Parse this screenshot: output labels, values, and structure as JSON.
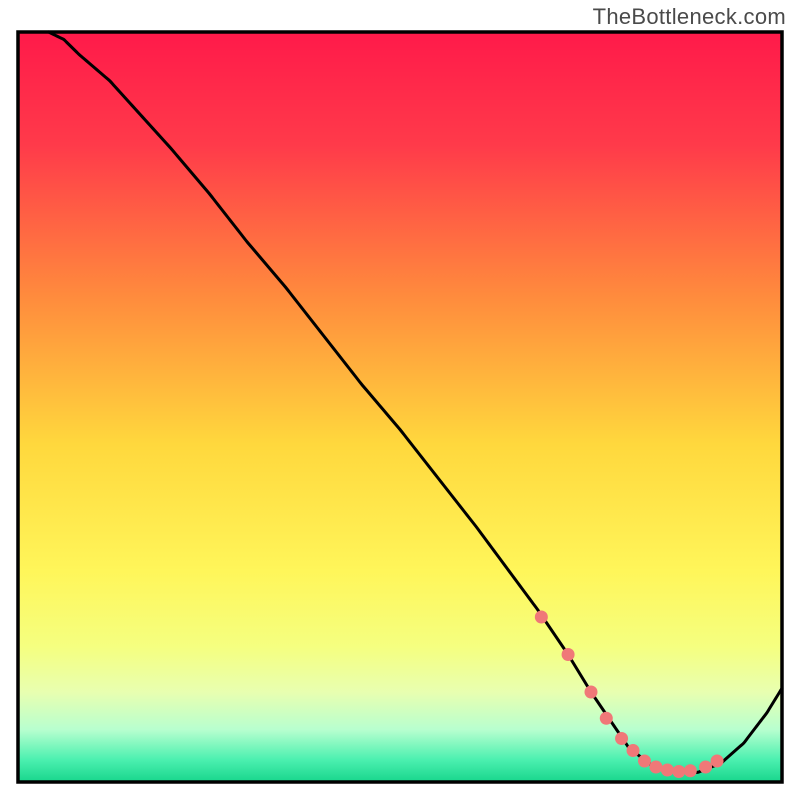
{
  "watermark": "TheBottleneck.com",
  "chart_data": {
    "type": "line",
    "title": "",
    "xlabel": "",
    "ylabel": "",
    "xlim": [
      0,
      100
    ],
    "ylim": [
      0,
      100
    ],
    "background_gradient": {
      "stops": [
        {
          "offset": 0,
          "color": "#ff1a4a"
        },
        {
          "offset": 15,
          "color": "#ff3a4a"
        },
        {
          "offset": 35,
          "color": "#ff8a3d"
        },
        {
          "offset": 55,
          "color": "#ffd83d"
        },
        {
          "offset": 72,
          "color": "#fff65a"
        },
        {
          "offset": 82,
          "color": "#f5ff80"
        },
        {
          "offset": 88,
          "color": "#e8ffb0"
        },
        {
          "offset": 93,
          "color": "#b8ffcf"
        },
        {
          "offset": 97,
          "color": "#4cf0b0"
        },
        {
          "offset": 100,
          "color": "#18d68c"
        }
      ]
    },
    "series": [
      {
        "name": "bottleneck-curve",
        "x": [
          4,
          6,
          8,
          12,
          16,
          20,
          25,
          30,
          35,
          40,
          45,
          50,
          55,
          60,
          64,
          68,
          72,
          75,
          78,
          80,
          83,
          86,
          89,
          92,
          95,
          98,
          100
        ],
        "y": [
          100,
          99,
          97,
          93.5,
          89,
          84.5,
          78.5,
          72,
          66,
          59.5,
          53,
          47,
          40.5,
          34,
          28.5,
          23,
          17,
          12,
          7.5,
          4.5,
          2.2,
          1.3,
          1.3,
          2.5,
          5.2,
          9.2,
          12.5
        ]
      }
    ],
    "markers": {
      "name": "highlight-points",
      "color": "#f07878",
      "x": [
        68.5,
        72,
        75,
        77,
        79,
        80.5,
        82,
        83.5,
        85,
        86.5,
        88,
        90,
        91.5
      ],
      "y": [
        22,
        17,
        12,
        8.5,
        5.8,
        4.2,
        2.8,
        2.0,
        1.6,
        1.4,
        1.5,
        2.0,
        2.8
      ]
    }
  }
}
